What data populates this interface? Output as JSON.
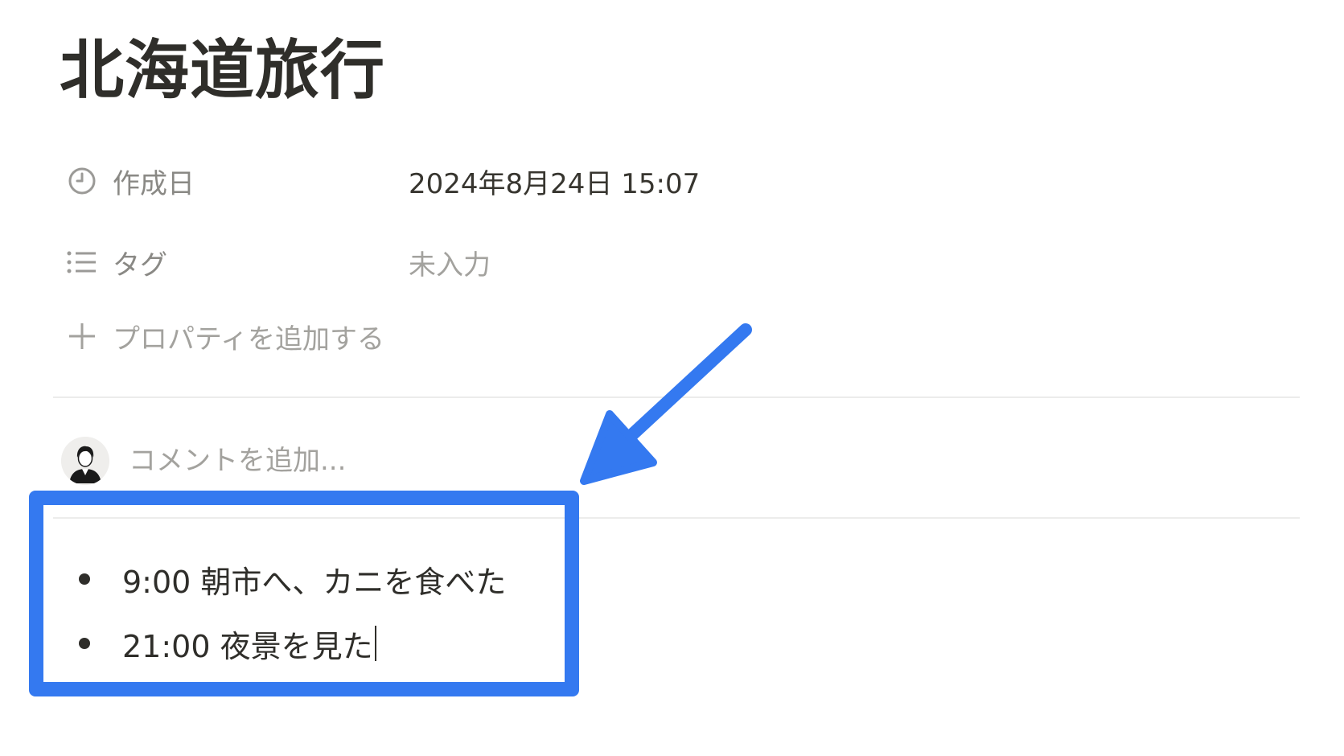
{
  "page": {
    "title": "北海道旅行"
  },
  "properties": [
    {
      "icon": "clock-icon",
      "label": "作成日",
      "value": "2024年8月24日 15:07",
      "empty": false
    },
    {
      "icon": "list-icon",
      "label": "タグ",
      "value": "未入力",
      "empty": true
    }
  ],
  "add_property": {
    "icon": "plus-icon",
    "label": "プロパティを追加する"
  },
  "comment": {
    "placeholder": "コメントを追加..."
  },
  "content": {
    "bullets": [
      "9:00 朝市へ、カニを食べた",
      "21:00 夜景を見た"
    ]
  },
  "annotation": {
    "color": "#3479f0"
  }
}
